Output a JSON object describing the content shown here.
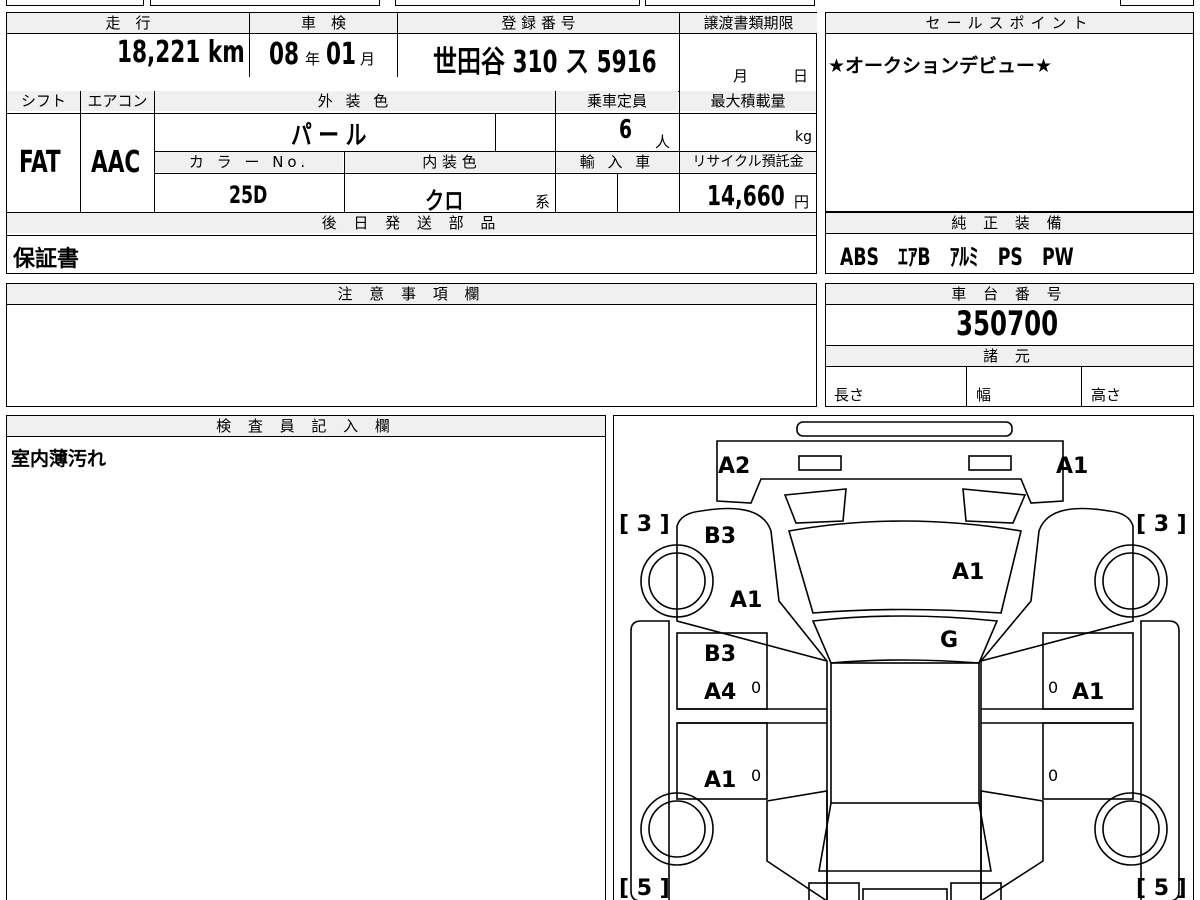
{
  "vehicle": {
    "mileage_label": "走　行",
    "mileage_value": "18,221",
    "mileage_unit": "km",
    "shaken_label": "車　検",
    "shaken_year": "08",
    "shaken_year_unit": "年",
    "shaken_month": "01",
    "shaken_month_unit": "月",
    "registration_label": "登 録 番 号",
    "registration_value": "世田谷 310 ス 5916",
    "transfer_deadline_label": "譲渡書類期限",
    "transfer_month_unit": "月",
    "transfer_day_unit": "日",
    "shift_label": "シフト",
    "shift_value": "FAT",
    "aircon_label": "エアコン",
    "aircon_value": "AAC",
    "exterior_color_label": "外 装 色",
    "exterior_color_value": "パ ー ル",
    "capacity_label": "乗車定員",
    "capacity_value": "6",
    "capacity_unit": "人",
    "max_load_label": "最大積載量",
    "max_load_unit": "kg",
    "color_no_label": "カ ラ ー No.",
    "color_no_value": "25D",
    "interior_color_label": "内 装 色",
    "interior_color_value": "クロ",
    "interior_color_unit": "系",
    "import_label": "輸 入 車",
    "recycle_label": "リサイクル預託金",
    "recycle_value": "14,660",
    "recycle_unit": "円"
  },
  "later_parts": {
    "label": "後 日 発 送 部 品",
    "value": "保証書"
  },
  "sales_point": {
    "label": "セールスポイント",
    "value": "★オークションデビュー★"
  },
  "equipment": {
    "label": "純 正 装 備",
    "value": "ABS　ｴｱB　ｱﾙﾐ　PS　PW"
  },
  "notes": {
    "label": "注 意 事 項 欄"
  },
  "chassis": {
    "label": "車 台 番 号",
    "value": "350700"
  },
  "specs": {
    "label": "諸 元",
    "length_label": "長さ",
    "width_label": "幅",
    "height_label": "高さ"
  },
  "inspector": {
    "label": "検 査 員 記 入 欄",
    "value": "室内薄汚れ"
  },
  "diagram": {
    "tire_fl": "[ 3 ]",
    "tire_fr": "[ 3 ]",
    "tire_rl": "[ 5 ]",
    "tire_rr": "[ 5 ]",
    "marks": [
      "A2",
      "A1",
      "B3",
      "A1",
      "A1",
      "G",
      "B3",
      "A4",
      "A1",
      "A1",
      "0",
      "0",
      "0",
      "0"
    ]
  }
}
